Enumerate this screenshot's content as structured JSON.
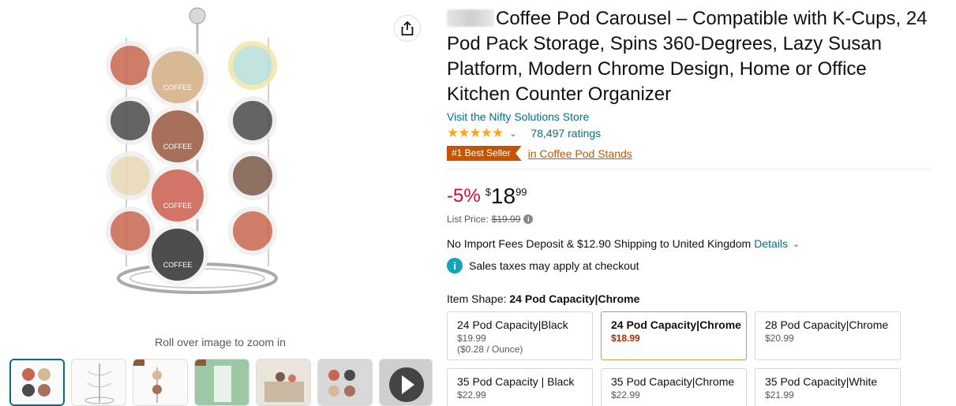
{
  "title": {
    "text": "Coffee Pod Carousel – Compatible with K-Cups, 24 Pod Pack Storage, Spins 360-Degrees, Lazy Susan Platform, Modern Chrome Design, Home or Office Kitchen Counter Organizer"
  },
  "store_link": "Visit the Nifty Solutions Store",
  "rating": {
    "stars": "★★★★★",
    "ratings_count": "78,497 ratings"
  },
  "bestseller": {
    "badge": "#1 Best Seller",
    "category": "in Coffee Pod Stands"
  },
  "price": {
    "discount": "-5%",
    "currency": "$",
    "whole": "18",
    "fraction": "99",
    "list_label": "List Price:",
    "list_value": "$19.99"
  },
  "shipping": {
    "text": "No Import Fees Deposit & $12.90 Shipping to United Kingdom",
    "details_link": "Details"
  },
  "tax_note": "Sales taxes may apply at checkout",
  "item_shape": {
    "label": "Item Shape:",
    "value": "24 Pod Capacity|Chrome"
  },
  "options": [
    {
      "name": "24 Pod Capacity|Black",
      "price": "$19.99",
      "unit": "($0.28 / Ounce)",
      "selected": false
    },
    {
      "name": "24 Pod Capacity|Chrome",
      "price": "$18.99",
      "unit": "",
      "selected": true
    },
    {
      "name": "28 Pod Capacity|Chrome",
      "price": "$20.99",
      "unit": "",
      "selected": false
    },
    {
      "name": "35 Pod Capacity | Black",
      "price": "$22.99",
      "unit": "",
      "selected": false
    },
    {
      "name": "35 Pod Capacity|Chrome",
      "price": "$22.99",
      "unit": "",
      "selected": false
    },
    {
      "name": "35 Pod Capacity|White",
      "price": "$21.99",
      "unit": "",
      "selected": false
    }
  ],
  "gallery": {
    "zoom_hint": "Roll over image to zoom in",
    "pod_label": "COFFEE"
  },
  "colors": {
    "link": "#007185",
    "badge": "#c45500",
    "discount": "#cc0c39",
    "selected_border": "#c7984a"
  }
}
